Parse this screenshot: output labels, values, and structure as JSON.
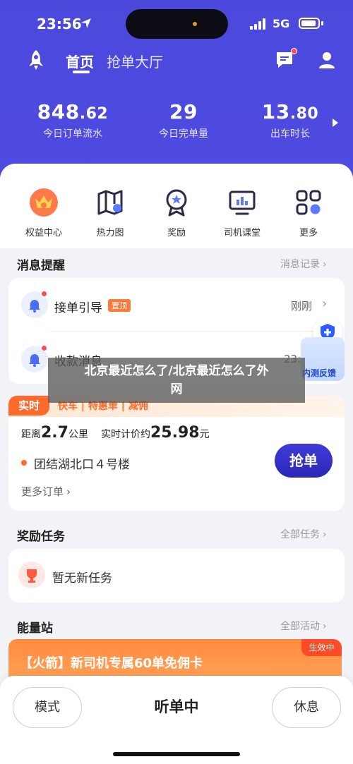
{
  "status_bar": {
    "time": "23:56",
    "network": "5G"
  },
  "nav": {
    "tab_home": "首页",
    "tab_hall": "抢单大厅"
  },
  "stats": [
    {
      "value_int": "848",
      "value_dec": ".62",
      "label": "今日订单流水"
    },
    {
      "value_int": "29",
      "value_dec": "",
      "label": "今日完单量"
    },
    {
      "value_int": "13",
      "value_dec": ".80",
      "label": "出车时长"
    }
  ],
  "grid": [
    {
      "label": "权益中心",
      "icon": "crown-badge-icon"
    },
    {
      "label": "热力图",
      "icon": "map-icon"
    },
    {
      "label": "奖励",
      "icon": "medal-icon"
    },
    {
      "label": "司机课堂",
      "icon": "screen-chart-icon"
    },
    {
      "label": "更多",
      "icon": "grid-more-icon"
    }
  ],
  "messages": {
    "title": "消息提醒",
    "more": "消息记录",
    "items": [
      {
        "title": "接单引导",
        "badge": "置顶",
        "time": "刚刚"
      },
      {
        "title": "收款消息",
        "time": "23:"
      }
    ]
  },
  "floating": {
    "feedback": "内测反馈"
  },
  "watermark": {
    "line1": "北京最近怎么了/北京最近怎么了外",
    "line2": "网"
  },
  "order": {
    "tag": "实时",
    "types": "快车 | 特惠单 | 减佣",
    "distance_label": "距离",
    "distance_value": "2.7",
    "distance_unit": "公里",
    "price_label": "实时计价约",
    "price_value": "25.98",
    "price_unit": "元",
    "address": "团结湖北口４号楼",
    "grab_label": "抢单",
    "more_orders": "更多订单"
  },
  "tasks": {
    "title": "奖励任务",
    "more": "全部任务",
    "empty": "暂无新任务"
  },
  "energy": {
    "title": "能量站",
    "more": "全部活动",
    "banner_text": "【火箭】新司机专属60单免佣卡",
    "banner_tag": "生效中"
  },
  "bottom": {
    "mode": "模式",
    "listening": "听单中",
    "rest": "休息"
  },
  "colors": {
    "primary": "#4b49dc",
    "accent": "#ff6a2b",
    "alert": "#ff4d4f"
  }
}
